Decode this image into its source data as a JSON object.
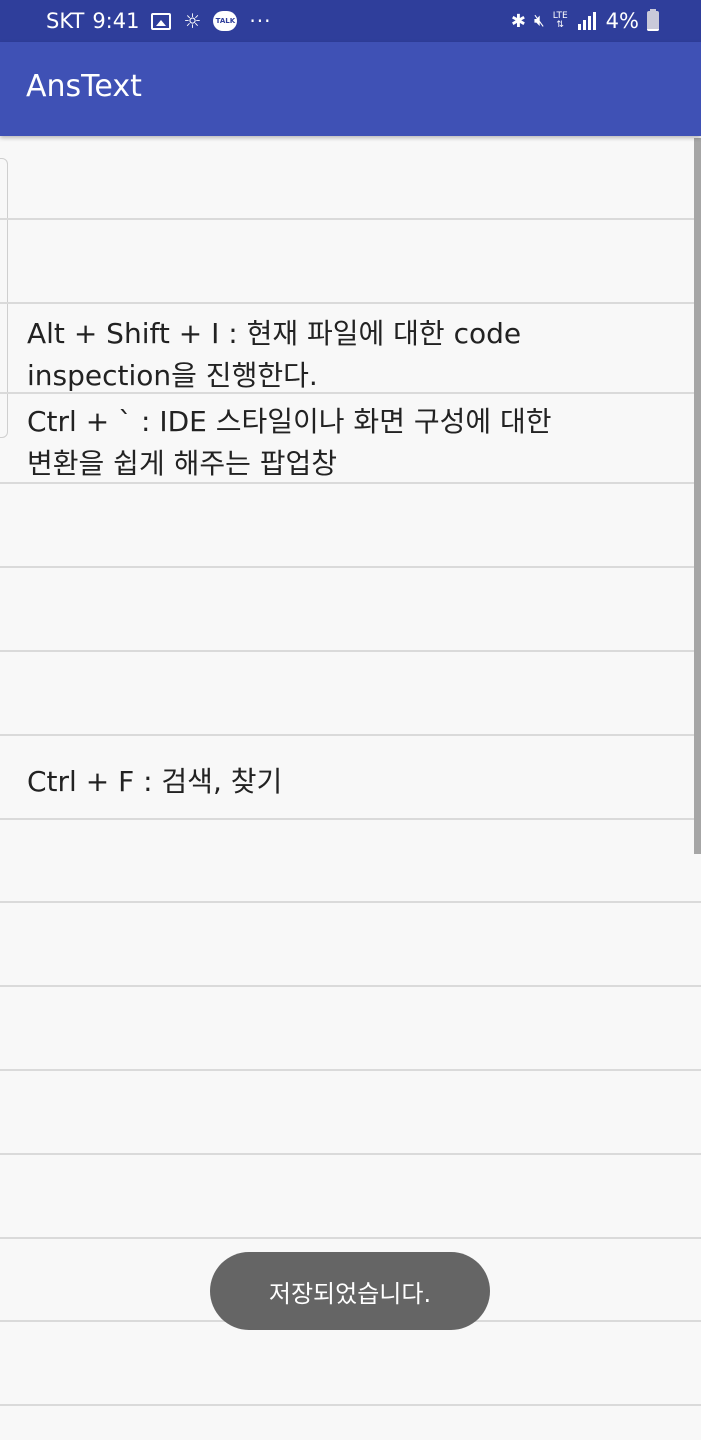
{
  "status_bar": {
    "carrier": "SKT",
    "time": "9:41",
    "left_icons": [
      "image-icon",
      "brightness-icon",
      "talk-icon",
      "more-icon"
    ],
    "talk_text": "TALK",
    "more_text": "···",
    "right_icons": [
      "bluetooth-icon",
      "mute-icon",
      "lte-icon",
      "signal-icon",
      "battery-icon"
    ],
    "lte_text": "LTE",
    "battery_percent": "4%",
    "battery_level": 0.04,
    "bg_color": "#2f3e9b"
  },
  "app_bar": {
    "title": "AnsText",
    "color": "#3f51b5"
  },
  "note": {
    "lines": [
      "Alt + Shift + I : 현재 파일에 대한 code",
      "inspection을 진행한다.",
      "Ctrl + ` : IDE 스타일이나 화면 구성에 대한",
      "변환을 쉽게 해주는 팝업창",
      "Ctrl + F : 검색, 찾기"
    ],
    "line_color": "#dadada",
    "background": "#f8f8f8"
  },
  "toast": {
    "message": "저장되었습니다."
  }
}
